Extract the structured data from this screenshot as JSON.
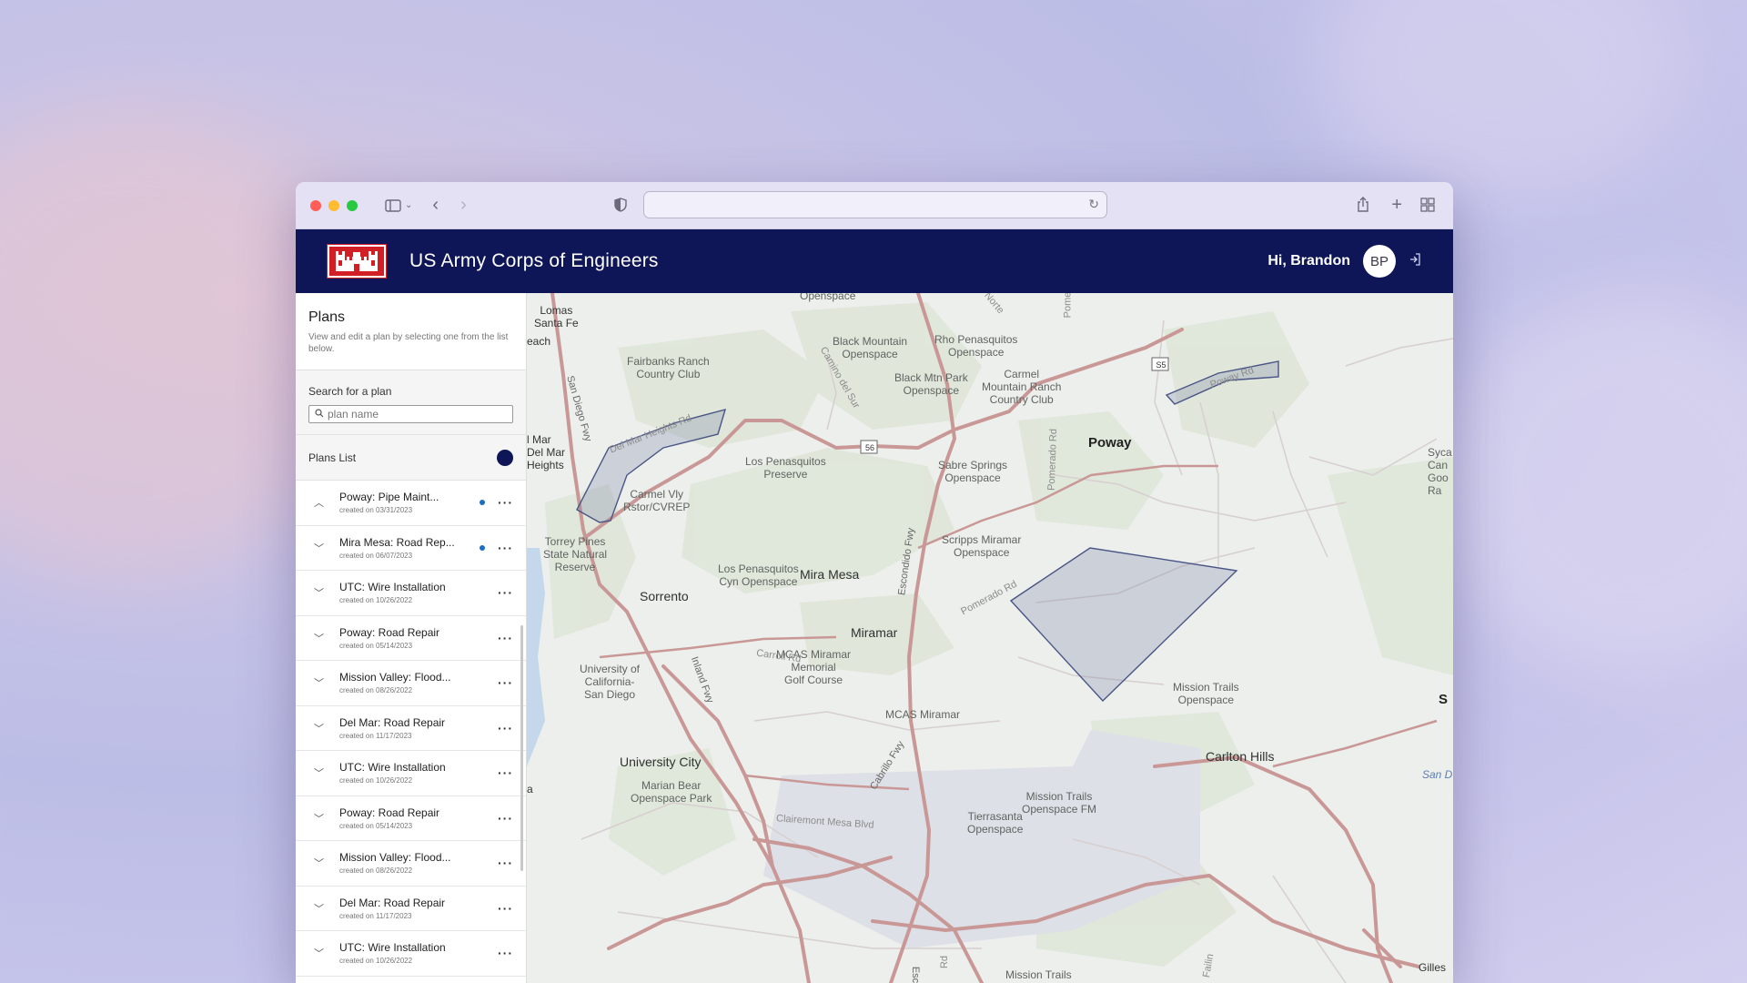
{
  "colors": {
    "brand_navy": "#0e1657",
    "logo_red": "#d21f26",
    "accent_blue": "#1a6fc4",
    "polygon_fill": "rgba(120,130,170,0.25)",
    "polygon_stroke": "#4a5586"
  },
  "browser": {
    "close_icon": "close-dot",
    "minimize_icon": "minimize-dot",
    "zoom_icon": "zoom-dot"
  },
  "app": {
    "title": "US Army Corps of Engineers",
    "greeting": "Hi, Brandon",
    "avatar_initials": "BP"
  },
  "sidebar": {
    "title": "Plans",
    "description": "View and edit a plan by selecting one from the list below.",
    "search_label": "Search for a plan",
    "search_placeholder": "plan name",
    "list_title": "Plans List",
    "plans": [
      {
        "name": "Poway: Pipe Maint...",
        "date": "created on 03/31/2023",
        "expanded": true,
        "flag": true
      },
      {
        "name": "Mira Mesa: Road Rep...",
        "date": "created on 06/07/2023",
        "expanded": false,
        "flag": true
      },
      {
        "name": "UTC: Wire Installation",
        "date": "created on 10/26/2022",
        "expanded": false,
        "flag": false
      },
      {
        "name": "Poway: Road Repair",
        "date": "created on 05/14/2023",
        "expanded": false,
        "flag": false
      },
      {
        "name": "Mission Valley: Flood...",
        "date": "created on 08/26/2022",
        "expanded": false,
        "flag": false
      },
      {
        "name": "Del Mar: Road Repair",
        "date": "created on 11/17/2023",
        "expanded": false,
        "flag": false
      },
      {
        "name": "UTC: Wire Installation",
        "date": "created on 10/26/2022",
        "expanded": false,
        "flag": false
      },
      {
        "name": "Poway: Road Repair",
        "date": "created on 05/14/2023",
        "expanded": false,
        "flag": false
      },
      {
        "name": "Mission Valley: Flood...",
        "date": "created on 08/26/2022",
        "expanded": false,
        "flag": false
      },
      {
        "name": "Del Mar: Road Repair",
        "date": "created on 11/17/2023",
        "expanded": false,
        "flag": false
      },
      {
        "name": "UTC: Wire Installation",
        "date": "created on 10/26/2022",
        "expanded": false,
        "flag": false
      }
    ]
  },
  "map": {
    "labels": {
      "lomas_santa_fe": "Lomas\nSanta Fe",
      "each": "each",
      "openspace_top": "Openspace",
      "fairbanks": "Fairbanks Ranch\nCountry Club",
      "black_mountain": "Black Mountain\nOpenspace",
      "rho_penasquitos": "Rho Penasquitos\nOpenspace",
      "black_mtn_park": "Black Mtn Park\nOpenspace",
      "carmel_mountain": "Carmel\nMountain Ranch\nCountry Club",
      "poway": "Poway",
      "sabre_springs": "Sabre Springs\nOpenspace",
      "los_penasquitos_preserve": "Los Penasquitos\nPreserve",
      "carmel_vly": "Carmel Vly\nRstor/CVREP",
      "del_mar_heights": "l Mar\nDel Mar\nHeights",
      "torrey_pines": "Torrey Pines\nState Natural\nReserve",
      "scripps_miramar": "Scripps Miramar\nOpenspace",
      "los_penasquitos_cyn": "Los Penasquitos\nCyn Openspace",
      "mira_mesa": "Mira Mesa",
      "sorrento": "Sorrento",
      "miramar": "Miramar",
      "mcas_golf": "MCAS Miramar\nMemorial\nGolf Course",
      "uc_san_diego": "University of\nCalifornia-\nSan Diego",
      "mcas_miramar": "MCAS Miramar",
      "mission_trails_os": "Mission Trails\nOpenspace",
      "university_city": "University City",
      "marian_bear": "Marian Bear\nOpenspace Park",
      "mission_trails_fm": "Mission Trails\nOpenspace FM",
      "tierrasanta": "Tierrasanta\nOpenspace",
      "carlton_hills": "Carlton Hills",
      "mission_trails_bottom": "Mission Trails",
      "gilles": "Gilles",
      "syca": "Syca\nCan\nGoo\nRa",
      "s_edge": "S",
      "a_edge": "a",
      "san_d": "San D",
      "road_san_diego_fwy": "San Diego Fwy",
      "road_camino": "Camino del Sur",
      "road_pomerado": "Pomerado Rd",
      "road_escondido": "Escondido Fwy",
      "road_inland": "Inland Fwy",
      "road_carroll": "Carroll Rd",
      "road_clairemont": "Clairemont Mesa Blvd",
      "road_cabrillo": "Cabrillo Fwy",
      "road_del_mar_heights": "Del Mar Heights Rd",
      "road_poway": "Poway Rd",
      "road_pomerado_2": "Pomerado Rd",
      "road_norte": "Norte",
      "road_pome": "Pome",
      "road_esc": "Esc",
      "road_rd": "Rd",
      "road_failin": "Failin",
      "shield_56": "56",
      "shield_s5": "S5"
    }
  }
}
